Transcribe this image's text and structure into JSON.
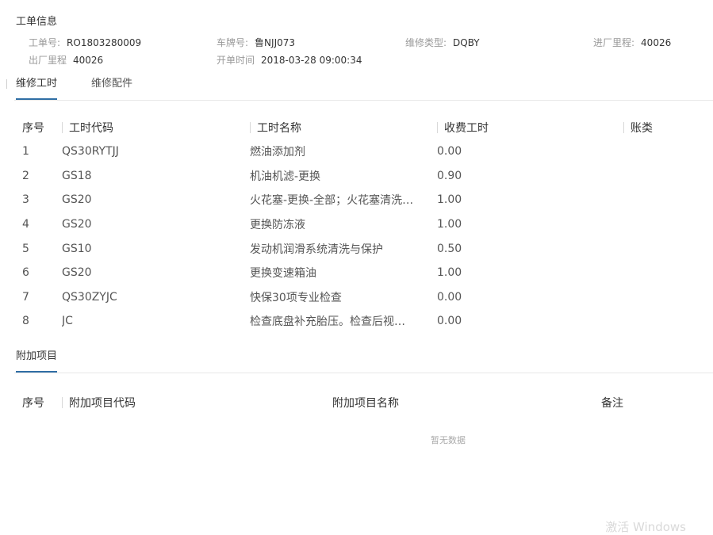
{
  "header": {
    "title": "工单信息"
  },
  "info": {
    "row1": [
      {
        "label": "工单号:",
        "value": "RO1803280009"
      },
      {
        "label": "车牌号:",
        "value": "鲁NJJ073"
      },
      {
        "label": "维修类型:",
        "value": "DQBY"
      },
      {
        "label": "进厂里程:",
        "value": "40026"
      }
    ],
    "row2": [
      {
        "label": "出厂里程",
        "value": "40026"
      },
      {
        "label": "开单时间",
        "value": "2018-03-28 09:00:34"
      }
    ]
  },
  "tabs": [
    {
      "label": "维修工时",
      "active": true
    },
    {
      "label": "维修配件",
      "active": false
    }
  ],
  "labor_table": {
    "headers": [
      "序号",
      "工时代码",
      "工时名称",
      "收费工时",
      "账类"
    ],
    "rows": [
      [
        "1",
        "QS30RYTJJ",
        "燃油添加剂",
        "0.00",
        ""
      ],
      [
        "2",
        "GS18",
        "机油机滤-更换",
        "0.90",
        ""
      ],
      [
        "3",
        "GS20",
        "火花塞-更换-全部；火花塞清洗…",
        "1.00",
        ""
      ],
      [
        "4",
        "GS20",
        "更换防冻液",
        "1.00",
        ""
      ],
      [
        "5",
        "GS10",
        "发动机润滑系统清洗与保护",
        "0.50",
        ""
      ],
      [
        "6",
        "GS20",
        "更换变速箱油",
        "1.00",
        ""
      ],
      [
        "7",
        "QS30ZYJC",
        "快保30项专业检查",
        "0.00",
        ""
      ],
      [
        "8",
        "JC",
        "检查底盘补充胎压。检查后视…",
        "0.00",
        ""
      ]
    ]
  },
  "extra": {
    "tab_label": "附加项目",
    "headers": [
      "序号",
      "附加项目代码",
      "附加项目名称",
      "备注"
    ],
    "empty_text": "暂无数据"
  },
  "watermark": "激活 Windows",
  "colors": {
    "accent": "#2f6ea5",
    "muted": "#999999",
    "border": "#e8e8e8"
  }
}
